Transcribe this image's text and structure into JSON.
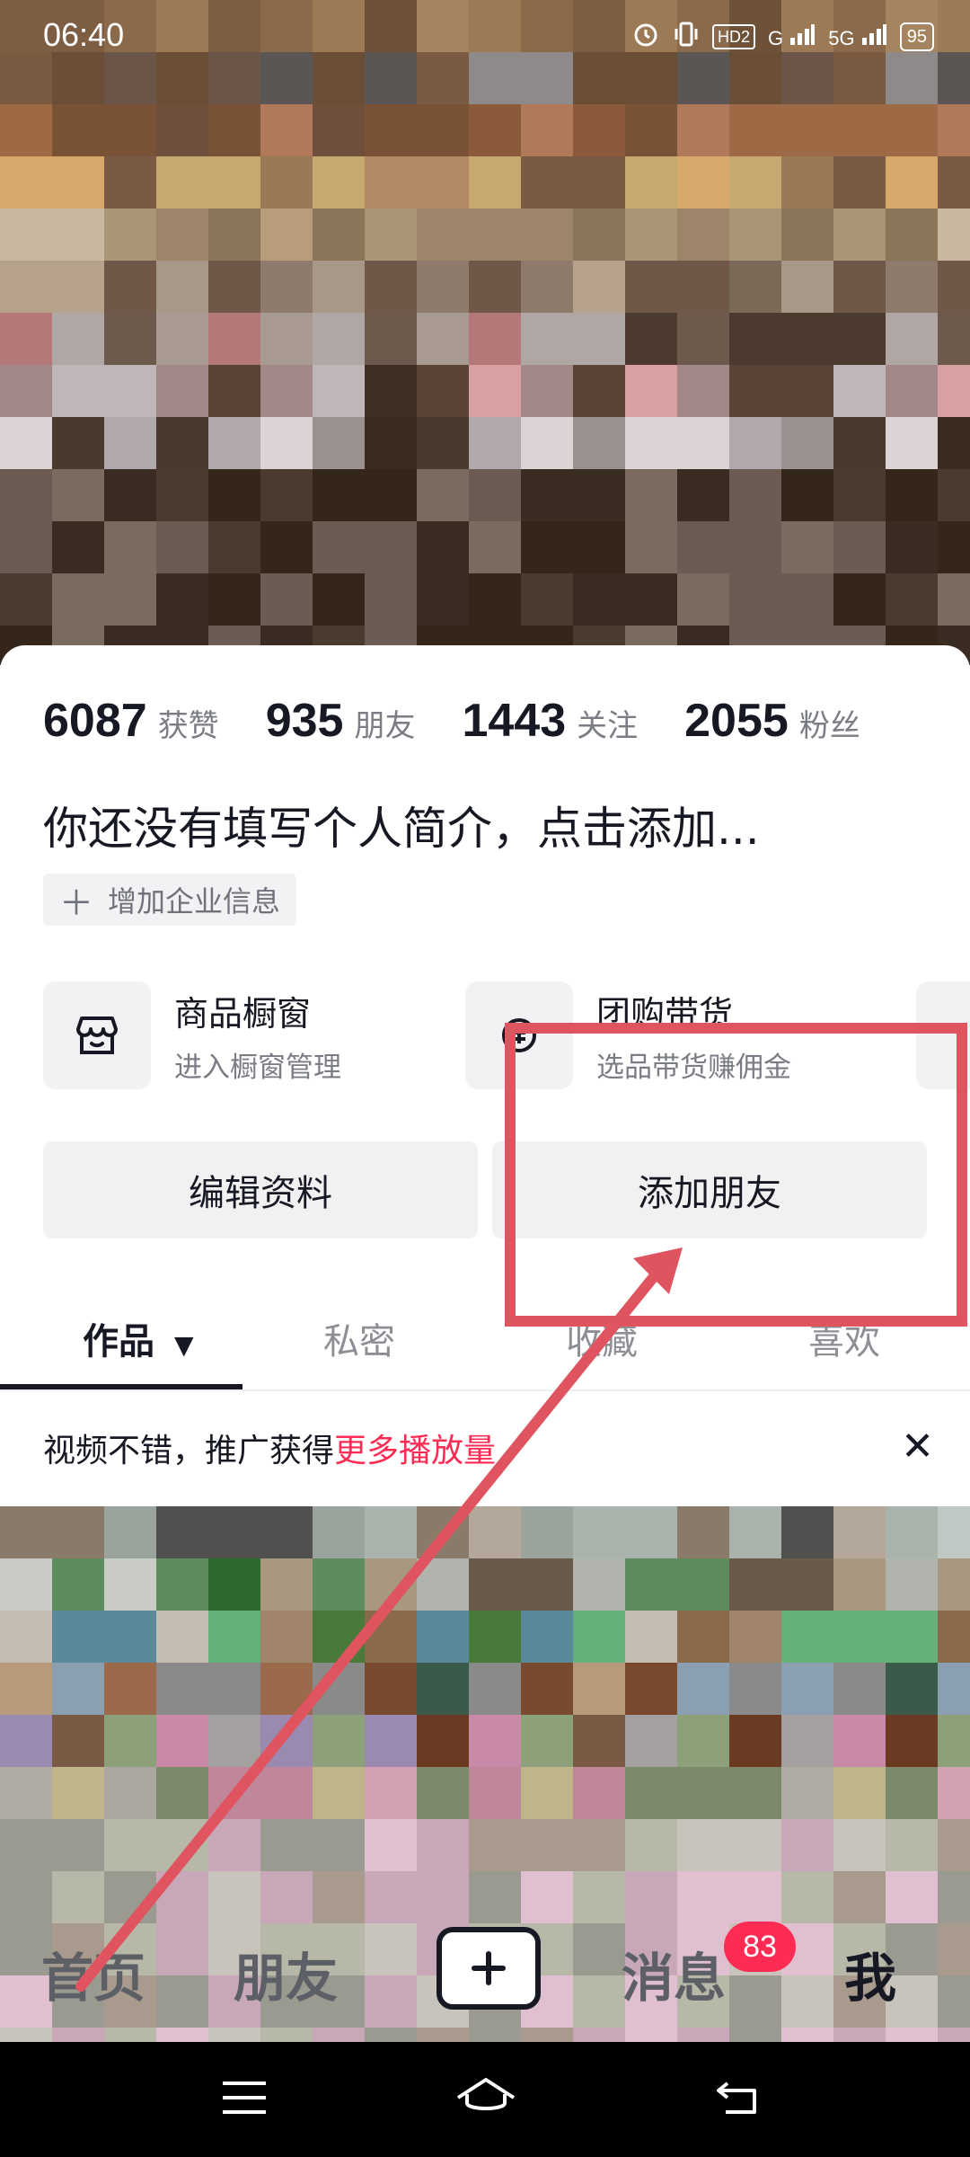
{
  "status_bar": {
    "time": "06:40",
    "network_label": "HD2",
    "signal_1": "G",
    "signal_2": "5G",
    "battery": "95"
  },
  "profile": {
    "stats": [
      {
        "value": "6087",
        "label": "获赞"
      },
      {
        "value": "935",
        "label": "朋友"
      },
      {
        "value": "1443",
        "label": "关注"
      },
      {
        "value": "2055",
        "label": "粉丝"
      }
    ],
    "bio_placeholder": "你还没有填写个人简介，点击添加...",
    "enterprise_button": "增加企业信息",
    "tools": [
      {
        "title": "商品橱窗",
        "subtitle": "进入橱窗管理",
        "icon": "storefront-icon"
      },
      {
        "title": "团购带货",
        "subtitle": "选品带货赚佣金",
        "icon": "group-buy-icon"
      }
    ],
    "edit_profile_button": "编辑资料",
    "add_friend_button": "添加朋友"
  },
  "tabs": {
    "items": [
      "作品",
      "私密",
      "收藏",
      "喜欢"
    ],
    "active_index": 0
  },
  "promo": {
    "text": "视频不错，推广获得",
    "highlight": "更多播放量",
    "close_icon": "close-icon"
  },
  "bottom_nav": {
    "items": [
      "首页",
      "朋友",
      "消息",
      "我"
    ],
    "create_icon": "plus-icon",
    "messages_badge": "83",
    "active": "我"
  },
  "colors": {
    "accent": "#fe2c55",
    "annotation": "#e0545f",
    "text_primary": "#161823",
    "text_secondary": "#7b7d85"
  }
}
